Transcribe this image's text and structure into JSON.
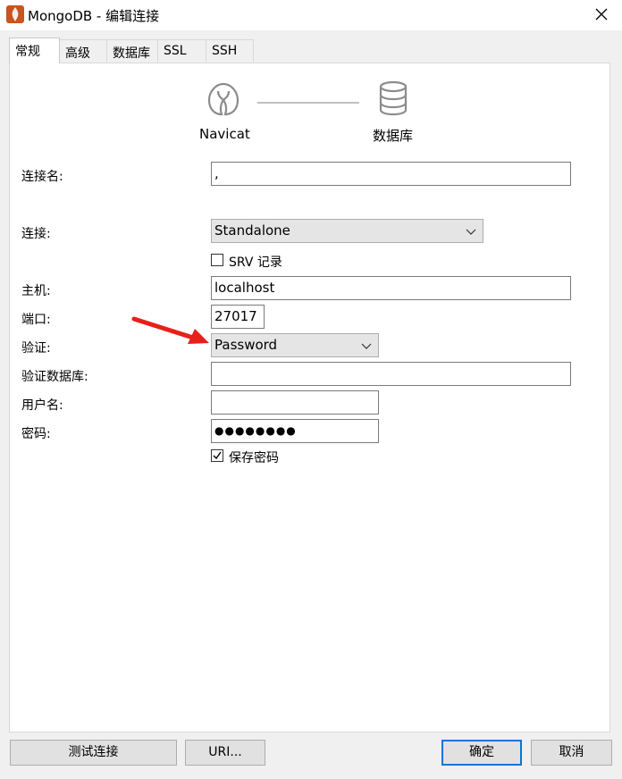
{
  "window": {
    "title": "MongoDB - 编辑连接",
    "icon": "mongodb-leaf-icon",
    "close_icon": "close-icon"
  },
  "tabs": [
    {
      "label": "常规",
      "active": true
    },
    {
      "label": "高级",
      "active": false
    },
    {
      "label": "数据库",
      "active": false
    },
    {
      "label": "SSL",
      "active": false
    },
    {
      "label": "SSH",
      "active": false
    }
  ],
  "diagram": {
    "source_label": "Navicat",
    "target_label": "数据库"
  },
  "form": {
    "connection_name": {
      "label": "连接名:",
      "value": ","
    },
    "connection_type": {
      "label": "连接:",
      "value": "Standalone"
    },
    "srv_record": {
      "label": "SRV 记录",
      "checked": false
    },
    "host": {
      "label": "主机:",
      "value": "localhost"
    },
    "port": {
      "label": "端口:",
      "value": "27017"
    },
    "auth": {
      "label": "验证:",
      "value": "Password"
    },
    "auth_db": {
      "label": "验证数据库:",
      "value": ""
    },
    "username": {
      "label": "用户名:",
      "value": ""
    },
    "password": {
      "label": "密码:",
      "value": "●●●●●●●●"
    },
    "save_password": {
      "label": "保存密码",
      "checked": true
    }
  },
  "annotation": {
    "color": "#e8201a"
  },
  "buttons": {
    "test": "测试连接",
    "uri": "URI...",
    "ok": "确定",
    "cancel": "取消"
  },
  "colors": {
    "accent": "#0078d7",
    "icon_gray": "#8c8c8c"
  }
}
